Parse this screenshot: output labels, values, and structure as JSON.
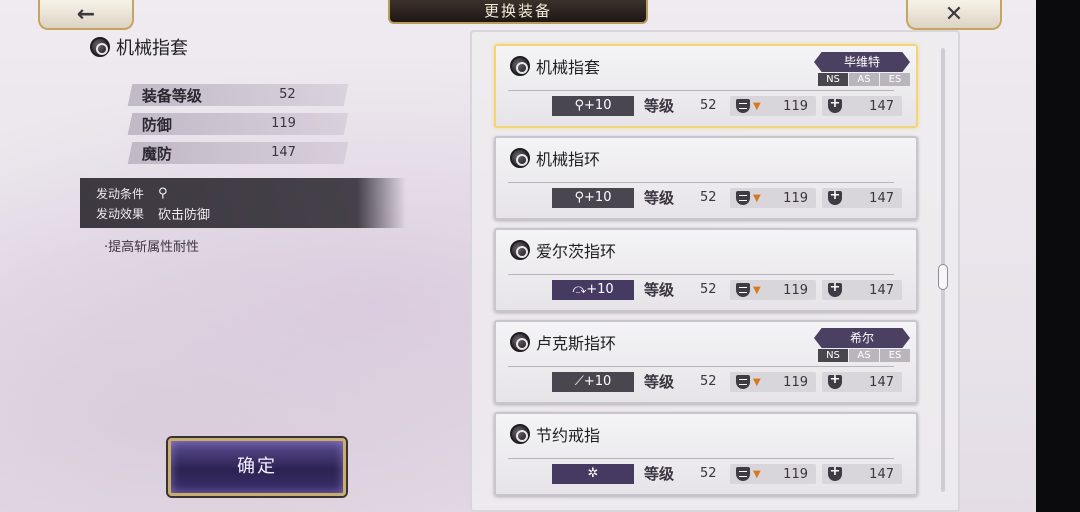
{
  "title": "更换装备",
  "nav": {
    "back_glyph": "←",
    "close_glyph": "✕"
  },
  "detail": {
    "name": "机械指套",
    "stats": [
      {
        "label": "装备等级",
        "value": "52"
      },
      {
        "label": "防御",
        "value": "119"
      },
      {
        "label": "魔防",
        "value": "147"
      }
    ],
    "skill": {
      "condition_label": "发动条件",
      "condition_icon": "⚲",
      "effect_label": "发动效果",
      "effect_value": "砍击防御"
    },
    "description": "·提高斩属性耐性"
  },
  "confirm_label": "确定",
  "level_label": "等级",
  "cards": [
    {
      "name": "机械指套",
      "badge": "⚲+10",
      "badge_style": "gray",
      "level": "52",
      "def": "119",
      "mdef": "147",
      "owner": "毕维特",
      "series": [
        "NS",
        "AS",
        "ES"
      ],
      "active_series": "NS",
      "selected": true
    },
    {
      "name": "机械指环",
      "badge": "⚲+10",
      "badge_style": "gray",
      "level": "52",
      "def": "119",
      "mdef": "147",
      "owner": "",
      "series": [],
      "selected": false
    },
    {
      "name": "爱尔茨指环",
      "badge": "⤼+10",
      "badge_style": "purple",
      "level": "52",
      "def": "119",
      "mdef": "147",
      "owner": "",
      "series": [],
      "selected": false
    },
    {
      "name": "卢克斯指环",
      "badge": "⟋+10",
      "badge_style": "gray",
      "level": "52",
      "def": "119",
      "mdef": "147",
      "owner": "希尔",
      "series": [
        "NS",
        "AS",
        "ES"
      ],
      "active_series": "NS",
      "selected": false
    },
    {
      "name": "节约戒指",
      "badge": "✲",
      "badge_style": "purple",
      "level": "52",
      "def": "119",
      "mdef": "147",
      "owner": "",
      "series": [],
      "selected": false
    }
  ],
  "colors": {
    "accent_gold": "#c9ad6a",
    "selected_border": "#f2d57a",
    "down_arrow": "#d8781e",
    "owner_tag": "#4b4062"
  },
  "icons": {
    "ring": "ring-icon",
    "defense": "shield-lines-icon",
    "magic_defense": "shield-plus-icon"
  }
}
